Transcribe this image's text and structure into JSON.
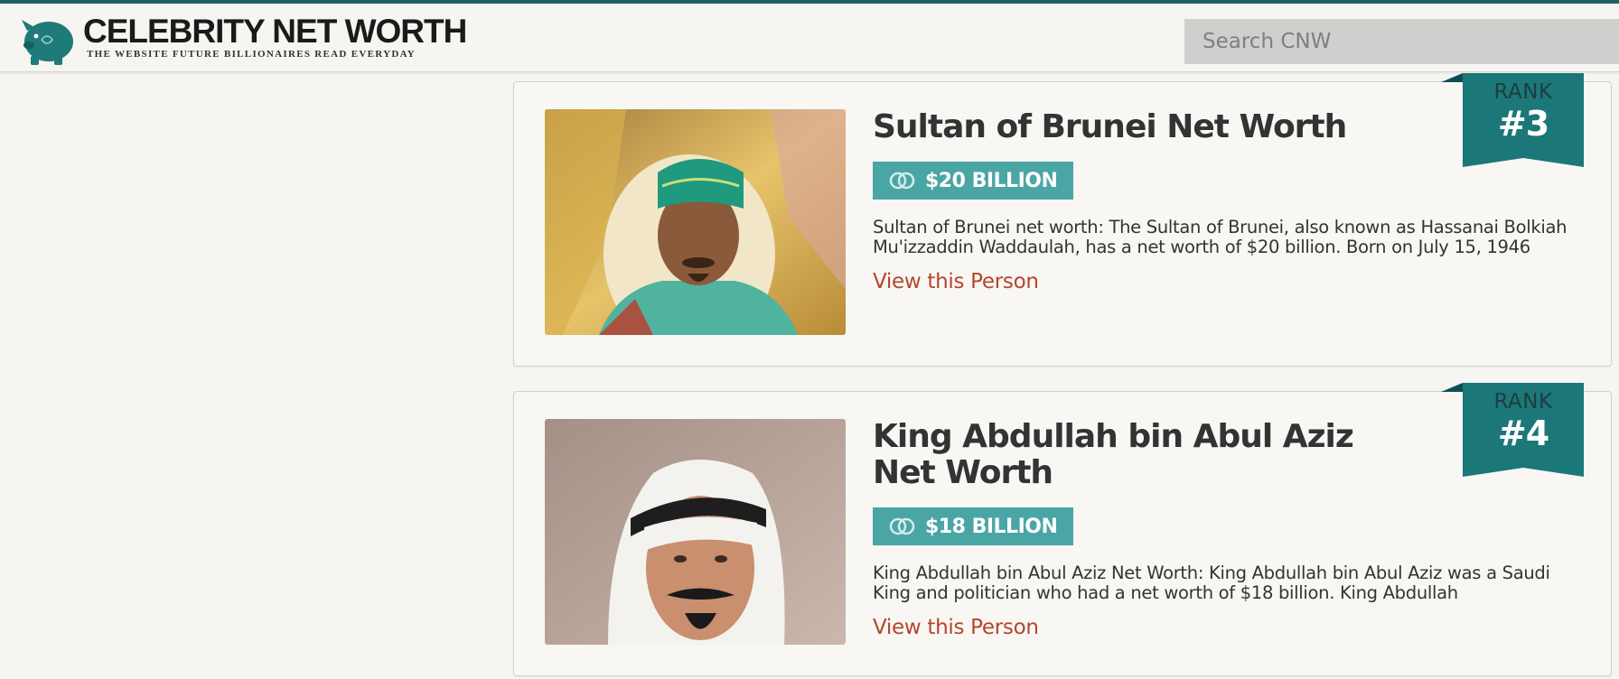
{
  "site": {
    "logo_title": "CELEBRITY NET WORTH",
    "logo_tagline": "THE WEBSITE FUTURE BILLIONAIRES READ EVERYDAY"
  },
  "search": {
    "placeholder": "Search CNW",
    "value": ""
  },
  "colors": {
    "brand_teal": "#1c7779",
    "badge_teal": "#4aa6a5",
    "link_red": "#b5452e",
    "background": "#f6f5f2"
  },
  "entries": [
    {
      "rank_label": "RANK",
      "rank": "#3",
      "name": "Sultan of Brunei Net Worth",
      "net_worth": "$20 BILLION",
      "description": "Sultan of Brunei net worth: The Sultan of Brunei, also known as Hassanai Bolkiah Mu'izzaddin Waddaulah, has a net worth of $20 billion. Born on July 15, 1946",
      "link": "View this Person",
      "icon": "coins-icon"
    },
    {
      "rank_label": "RANK",
      "rank": "#4",
      "name": "King Abdullah bin Abul Aziz Net Worth",
      "net_worth": "$18 BILLION",
      "description": "King Abdullah bin Abul Aziz Net Worth: King Abdullah bin Abul Aziz was a Saudi King and politician who had a net worth of $18 billion. King Abdullah",
      "link": "View this Person",
      "icon": "coins-icon"
    }
  ]
}
